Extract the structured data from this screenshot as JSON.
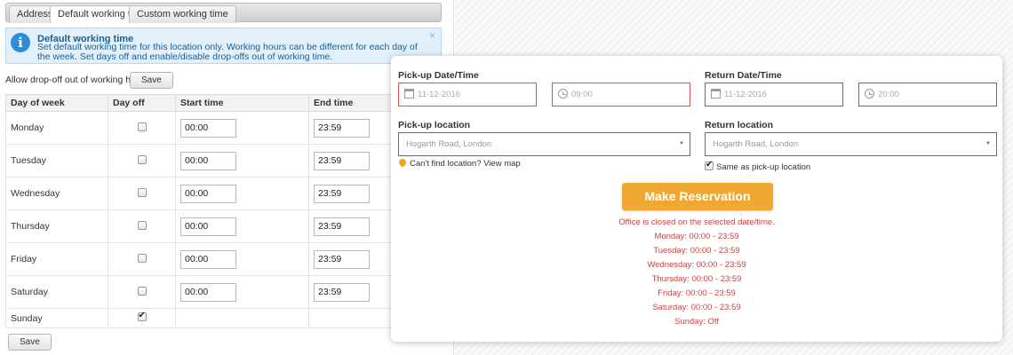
{
  "tabs": [
    {
      "label": "Address"
    },
    {
      "label": "Default working time"
    },
    {
      "label": "Custom working time"
    }
  ],
  "info": {
    "title": "Default working time",
    "text": "Set default working time for this location only. Working hours can be different for each day of the week. Set days off and enable/disable drop-offs out of working time.",
    "close": "×"
  },
  "allow_dropoff": {
    "label": "Allow drop-off out of working hours",
    "checked": false
  },
  "save_label": "Save",
  "table": {
    "headers": [
      "Day of week",
      "Day off",
      "Start time",
      "End time"
    ],
    "rows": [
      {
        "day": "Monday",
        "off": false,
        "start": "00:00",
        "end": "23:59"
      },
      {
        "day": "Tuesday",
        "off": false,
        "start": "00:00",
        "end": "23:59"
      },
      {
        "day": "Wednesday",
        "off": false,
        "start": "00:00",
        "end": "23:59"
      },
      {
        "day": "Thursday",
        "off": false,
        "start": "00:00",
        "end": "23:59"
      },
      {
        "day": "Friday",
        "off": false,
        "start": "00:00",
        "end": "23:59"
      },
      {
        "day": "Saturday",
        "off": false,
        "start": "00:00",
        "end": "23:59"
      },
      {
        "day": "Sunday",
        "off": true,
        "start": "",
        "end": ""
      }
    ]
  },
  "widget": {
    "pickup_datetime_label": "Pick-up Date/Time",
    "return_datetime_label": "Return Date/Time",
    "pickup_date": "11-12-2016",
    "pickup_time": "09:00",
    "return_date": "11-12-2016",
    "return_time": "20:00",
    "pickup_location_label": "Pick-up location",
    "return_location_label": "Return location",
    "pickup_location": "Hogarth Road, London",
    "return_location": "Hogarth Road, London",
    "cant_find": "Can't find location? View map",
    "same_as_pickup": "Same as pick-up location",
    "same_as_pickup_checked": true,
    "make_reservation": "Make Reservation",
    "closed_message": "Office is closed on the selected date/time.",
    "hours": [
      "Monday: 00:00 - 23:59",
      "Tuesday: 00:00 - 23:59",
      "Wednesday: 00:00 - 23:59",
      "Thursday: 00:00 - 23:59",
      "Friday: 00:00 - 23:59",
      "Saturday: 00:00 - 23:59",
      "Sunday: Off"
    ],
    "colors": {
      "accent": "#f0a833",
      "error": "#c74444",
      "error_border": "#d9534f"
    }
  }
}
